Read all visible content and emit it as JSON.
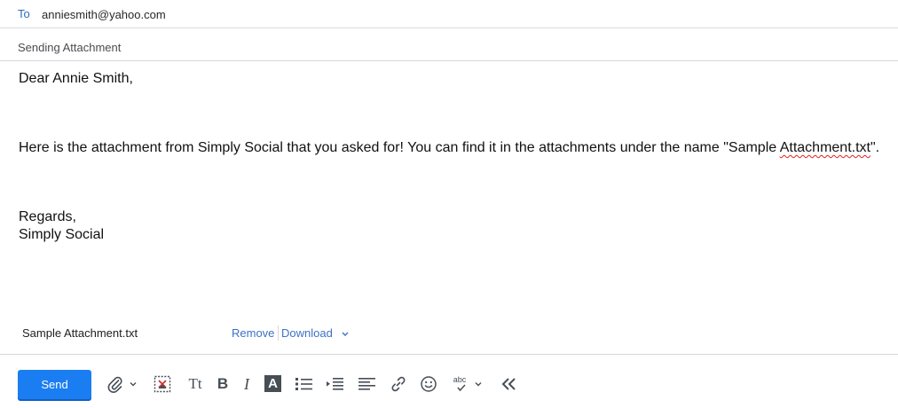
{
  "compose": {
    "to_label": "To",
    "to_value": "anniesmith@yahoo.com",
    "subject": "Sending Attachment"
  },
  "body": {
    "greeting": "Dear Annie Smith,",
    "line1_part1": "Here is the attachment from Simply Social that you asked for! You can find it in the attachments under the name \"Sample ",
    "line1_misspelled": "Attachment.txt",
    "line1_part2": "\".",
    "closing": "Regards,",
    "signature": "Simply Social"
  },
  "attachment": {
    "filename": "Sample Attachment.txt",
    "remove_label": "Remove",
    "download_label": "Download"
  },
  "toolbar": {
    "send_label": "Send",
    "icons": [
      "paperclip-icon",
      "chevron-down-icon",
      "insert-image-icon",
      "font-size-icon",
      "bold-icon",
      "italic-icon",
      "text-color-icon",
      "bulleted-list-icon",
      "indent-icon",
      "align-left-icon",
      "link-icon",
      "emoji-icon",
      "spellcheck-icon",
      "chevron-down-icon",
      "collapse-toolbar-icon"
    ],
    "font_size_glyph": "Tt",
    "bold_glyph": "B",
    "italic_glyph": "I",
    "text_color_glyph": "A",
    "spellcheck_glyph": "abc"
  },
  "colors": {
    "accent": "#1a7ef2",
    "link": "#3d72c4",
    "to_label": "#2e6bb8",
    "divider": "#d8d8dc",
    "spellcheck_underline": "#e02020"
  }
}
